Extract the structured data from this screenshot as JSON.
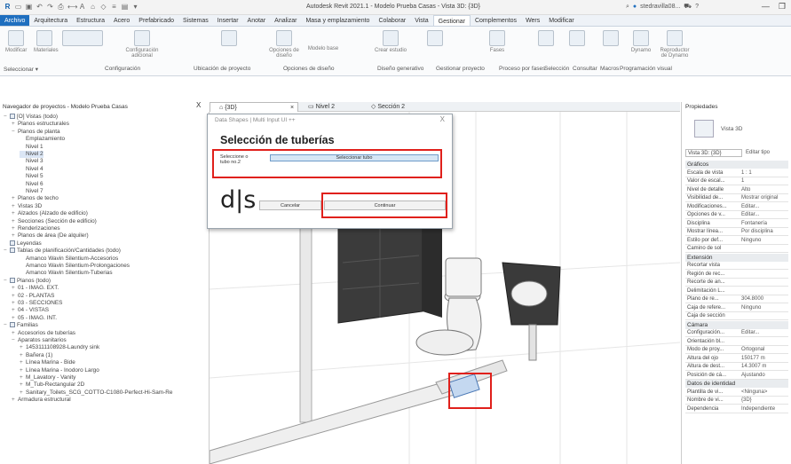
{
  "titlebar": {
    "window_title": "Autodesk Revit 2021.1 - Modelo Prueba Casas - Vista 3D: {3D}",
    "user": "stedravilla08...",
    "help": "?"
  },
  "tabs": [
    "Archivo",
    "Arquitectura",
    "Estructura",
    "Acero",
    "Prefabricado",
    "Sistemas",
    "Insertar",
    "Anotar",
    "Analizar",
    "Masa y emplazamiento",
    "Colaborar",
    "Vista",
    "Gestionar",
    "Complementos",
    "Wers",
    "Modificar"
  ],
  "ribbon": {
    "panel_labels": [
      "Seleccionar ▾",
      "Configuración",
      "Ubicación de proyecto",
      "Opciones de diseño",
      "Diseño generativo",
      "Gestionar proyecto",
      "Proceso por fases",
      "Selección",
      "Consultar",
      "Macros",
      "Programación visual"
    ],
    "buttons": [
      "Modificar",
      "Materiales",
      "Configuración adicional",
      "Opciones de diseño",
      "Modelo base",
      "Crear estudio",
      "Gestionar fases",
      "Fases",
      "Dynamo",
      "Reproductor de Dynamo"
    ]
  },
  "project_browser": {
    "header": "Navegador de proyectos - Modelo Prueba Casas",
    "close": "X",
    "items": [
      {
        "toggle": "−",
        "icon": true,
        "label": "[O] Vistas (todo)",
        "indent": 0
      },
      {
        "toggle": "+",
        "icon": false,
        "label": "Planos estructurales",
        "indent": 1
      },
      {
        "toggle": "−",
        "icon": false,
        "label": "Planos de planta",
        "indent": 1
      },
      {
        "toggle": "",
        "icon": false,
        "label": "Emplazamiento",
        "indent": 2
      },
      {
        "toggle": "",
        "icon": false,
        "label": "Nivel 1",
        "indent": 2
      },
      {
        "toggle": "",
        "icon": false,
        "label": "Nivel 2",
        "indent": 2
      },
      {
        "toggle": "",
        "icon": false,
        "label": "Nivel 3",
        "indent": 2
      },
      {
        "toggle": "",
        "icon": false,
        "label": "Nivel 4",
        "indent": 2
      },
      {
        "toggle": "",
        "icon": false,
        "label": "Nivel 5",
        "indent": 2
      },
      {
        "toggle": "",
        "icon": false,
        "label": "Nivel 6",
        "indent": 2
      },
      {
        "toggle": "",
        "icon": false,
        "label": "Nivel 7",
        "indent": 2
      },
      {
        "toggle": "+",
        "icon": false,
        "label": "Planos de techo",
        "indent": 1
      },
      {
        "toggle": "+",
        "icon": false,
        "label": "Vistas 3D",
        "indent": 1
      },
      {
        "toggle": "+",
        "icon": false,
        "label": "Alzados (Alzado de edificio)",
        "indent": 1
      },
      {
        "toggle": "+",
        "icon": false,
        "label": "Secciones (Sección de edificio)",
        "indent": 1
      },
      {
        "toggle": "+",
        "icon": false,
        "label": "Renderizaciones",
        "indent": 1
      },
      {
        "toggle": "+",
        "icon": false,
        "label": "Planos de área (De alquiler)",
        "indent": 1
      },
      {
        "toggle": "",
        "icon": true,
        "label": "Leyendas",
        "indent": 0
      },
      {
        "toggle": "−",
        "icon": true,
        "label": "Tablas de planificación/Cantidades (todo)",
        "indent": 0
      },
      {
        "toggle": "",
        "icon": false,
        "label": "Amanco Wavin Silentium-Accesorios",
        "indent": 2
      },
      {
        "toggle": "",
        "icon": false,
        "label": "Amanco Wavin Silentium-Prolongaciones",
        "indent": 2
      },
      {
        "toggle": "",
        "icon": false,
        "label": "Amanco Wavin Silentium-Tuberias",
        "indent": 2
      },
      {
        "toggle": "−",
        "icon": true,
        "label": "Planos (todo)",
        "indent": 0
      },
      {
        "toggle": "+",
        "icon": false,
        "label": "01 - IMAG. EXT.",
        "indent": 1
      },
      {
        "toggle": "+",
        "icon": false,
        "label": "02 - PLANTAS",
        "indent": 1
      },
      {
        "toggle": "+",
        "icon": false,
        "label": "03 - SECCIONES",
        "indent": 1
      },
      {
        "toggle": "+",
        "icon": false,
        "label": "04 - VISTAS",
        "indent": 1
      },
      {
        "toggle": "+",
        "icon": false,
        "label": "05 - IMAG. INT.",
        "indent": 1
      },
      {
        "toggle": "−",
        "icon": true,
        "label": "Familias",
        "indent": 0
      },
      {
        "toggle": "+",
        "icon": false,
        "label": "Accesorios de tuberías",
        "indent": 1
      },
      {
        "toggle": "−",
        "icon": false,
        "label": "Aparatos sanitarios",
        "indent": 1
      },
      {
        "toggle": "+",
        "icon": false,
        "label": "1453111108928-Laundry sink",
        "indent": 2
      },
      {
        "toggle": "+",
        "icon": false,
        "label": "Bañera (1)",
        "indent": 2
      },
      {
        "toggle": "+",
        "icon": false,
        "label": "Línea Marina - Bide",
        "indent": 2
      },
      {
        "toggle": "+",
        "icon": false,
        "label": "Línea Marina - Inodoro Largo",
        "indent": 2
      },
      {
        "toggle": "+",
        "icon": false,
        "label": "M_Lavatory - Vanity",
        "indent": 2
      },
      {
        "toggle": "+",
        "icon": false,
        "label": "M_Tub-Rectangular 2D",
        "indent": 2
      },
      {
        "toggle": "+",
        "icon": false,
        "label": "Sanitary_Toilets_SCG_COTTO-C1080-Perfect-Hi-Sam-Re",
        "indent": 2
      },
      {
        "toggle": "+",
        "icon": false,
        "label": "Armadura estructural",
        "indent": 1
      }
    ]
  },
  "view_tabs": [
    {
      "label": "{3D}",
      "active": true
    },
    {
      "label": "Nivel 2",
      "active": false
    },
    {
      "label": "Sección 2",
      "active": false
    }
  ],
  "dialog": {
    "title": "Data Shapes | Multi Input UI ++",
    "close": "X",
    "heading": "Selección de tuberías",
    "field_label": "Seleccione o tubo no.2",
    "pick_button": "Seleccionar tubo",
    "logo": "d|s",
    "cancel": "Cancelar",
    "continue": "Continuar"
  },
  "properties": {
    "header": "Propiedades",
    "type_name": "Vista 3D",
    "instance": "Vista 3D: {3D}",
    "edit_type": "Editar tipo",
    "rows": [
      {
        "cat": "Gráficos"
      },
      {
        "k": "Escala de vista",
        "v": "1 : 1"
      },
      {
        "k": "Valor de escal...",
        "v": "1"
      },
      {
        "k": "Nivel de detalle",
        "v": "Alto"
      },
      {
        "k": "Visibilidad de...",
        "v": "Mostrar original"
      },
      {
        "k": "Modificaciones...",
        "v": "Editar..."
      },
      {
        "k": "Opciones de v...",
        "v": "Editar..."
      },
      {
        "k": "Disciplina",
        "v": "Fontanería"
      },
      {
        "k": "Mostrar línea...",
        "v": "Por disciplina"
      },
      {
        "k": "Estilo por def...",
        "v": "Ninguno"
      },
      {
        "k": "Camino de sol",
        "v": ""
      },
      {
        "cat": "Extensión"
      },
      {
        "k": "Recortar vista",
        "v": ""
      },
      {
        "k": "Región de rec...",
        "v": ""
      },
      {
        "k": "Recorte de an...",
        "v": ""
      },
      {
        "k": "Delimitación L...",
        "v": ""
      },
      {
        "k": "Plano de re...",
        "v": "304.8000"
      },
      {
        "k": "Caja de refere...",
        "v": "Ninguno"
      },
      {
        "k": "Caja de sección",
        "v": ""
      },
      {
        "cat": "Cámara"
      },
      {
        "k": "Configuración...",
        "v": "Editar..."
      },
      {
        "k": "Orientación bl...",
        "v": ""
      },
      {
        "k": "Modo de proy...",
        "v": "Ortogonal"
      },
      {
        "k": "Altura del ojo",
        "v": "150177 m"
      },
      {
        "k": "Altura de dest...",
        "v": "14.3007 m"
      },
      {
        "k": "Posición de cá...",
        "v": "Ajustando"
      },
      {
        "cat": "Datos de identidad"
      },
      {
        "k": "Plantilla de vi...",
        "v": "<Ninguna>"
      },
      {
        "k": "Nombre de vi...",
        "v": "{3D}"
      },
      {
        "k": "Dependencia",
        "v": "Independiente"
      }
    ]
  }
}
